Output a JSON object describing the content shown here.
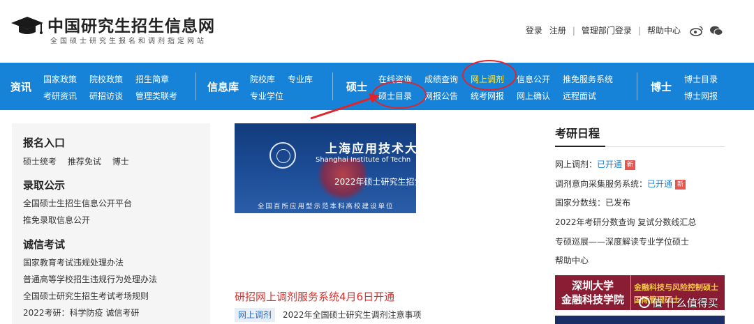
{
  "header": {
    "site_title": "中国研究生招生信息网",
    "site_subtitle": "全国硕士研究生报名和调剂指定网站",
    "links": [
      "登录",
      "注册",
      "管理部门登录",
      "帮助中心"
    ],
    "separators": [
      "|",
      "|",
      "|"
    ],
    "icons": [
      "weibo-icon",
      "wechat-icon"
    ]
  },
  "nav": {
    "sections": [
      {
        "title": "资讯",
        "links": [
          "国家政策",
          "院校政策",
          "招生简章",
          "考研资讯",
          "研招访谈",
          "管理类联考"
        ]
      },
      {
        "title": "信息库",
        "links": [
          "院校库",
          "专业库",
          "专业学位"
        ]
      },
      {
        "title": "硕士",
        "links": [
          "在线咨询",
          "成绩查询",
          "网上调剂",
          "信息公开",
          "推免服务系统",
          "硕士目录",
          "网报公告",
          "统考网报",
          "网上确认",
          "远程面试"
        ]
      },
      {
        "title": "博士",
        "links": [
          "博士目录",
          "博士网报"
        ]
      }
    ],
    "highlight_color": "#ffe94a",
    "bg_color": "#1783d8"
  },
  "left_panel": {
    "sections": [
      {
        "heading": "报名入口",
        "items": [
          "硕士统考",
          "推荐免试",
          "博士"
        ]
      },
      {
        "heading": "录取公示",
        "items": [
          "全国硕士生招生信息公开平台",
          "推免录取信息公开"
        ]
      },
      {
        "heading": "诚信考试",
        "items": [
          "国家教育考试违规处理办法",
          "普通高等学校招生违规行为处理办法",
          "全国硕士研究生招生考试考场规则",
          "2022考研：科学防疫 诚信考研"
        ]
      }
    ]
  },
  "banner": {
    "school_name": "上海应用技术大",
    "school_name_en": "Shanghai Institute of Techn",
    "caption": "2022年硕士研究生招生",
    "footer": "全国百所应用型示范本科高校建设单位"
  },
  "news": {
    "headline": "研招网上调剂服务系统4月6日开通",
    "tag": "网上调剂",
    "item": "2022年全国硕士研究生调剂注意事项"
  },
  "schedule": {
    "heading": "考研日程",
    "items": [
      {
        "text": "网上调剂：",
        "link": "已开通",
        "badge": "新"
      },
      {
        "text": "调剂意向采集服务系统：",
        "link": "已开通",
        "badge": "新"
      },
      {
        "text": "国家分数线：已发布"
      },
      {
        "text": "2022年考研分数查询 复试分数线汇总"
      },
      {
        "text": "专硕巡展——深度解读专业学位硕士"
      },
      {
        "text": "帮助中心"
      }
    ]
  },
  "ad": {
    "left": [
      "深圳大学",
      "金融科技学院"
    ],
    "right": [
      "金融科技与风险控制硕士",
      "国际管理硕士"
    ]
  },
  "watermark": "值 什么值得买",
  "annotation_color": "#e0242b"
}
